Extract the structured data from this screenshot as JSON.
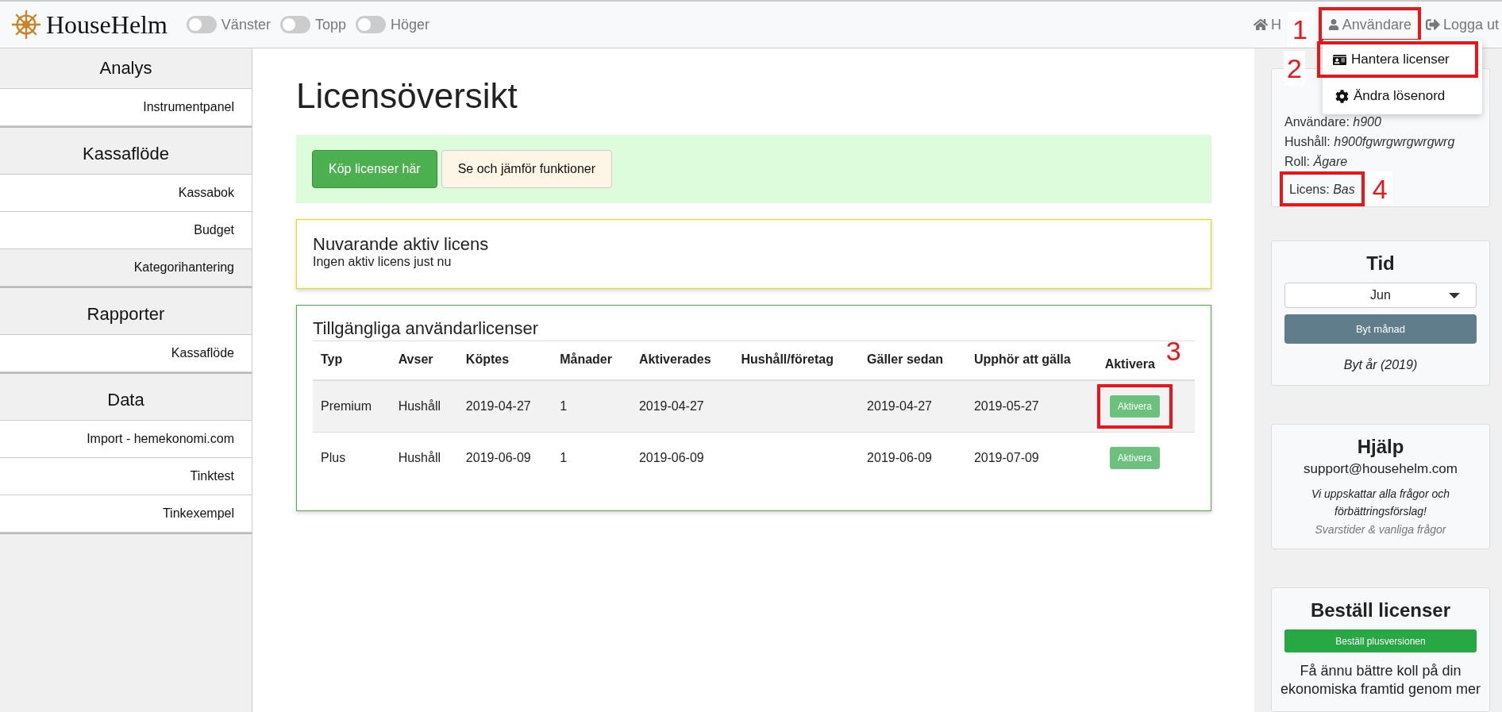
{
  "header": {
    "brand": "HouseHelm",
    "toggles": [
      {
        "label": "Vänster",
        "on": false
      },
      {
        "label": "Topp",
        "on": false
      },
      {
        "label": "Höger",
        "on": false
      }
    ],
    "nav": {
      "home": "H",
      "user": "Användare",
      "user_note": "1",
      "logout": "Logga ut"
    }
  },
  "user_menu": {
    "items": [
      {
        "kind": "license",
        "label": "Hantera licenser",
        "note": "2"
      },
      {
        "kind": "settings",
        "label": "Ändra lösenord"
      }
    ]
  },
  "sidebar": {
    "sections": [
      {
        "title": "Analys",
        "items": [
          {
            "label": "Instrumentpanel",
            "selected": false
          }
        ]
      },
      {
        "title": "Kassaflöde",
        "items": [
          {
            "label": "Kassabok",
            "selected": false
          },
          {
            "label": "Budget",
            "selected": false
          },
          {
            "label": "Kategorihantering",
            "selected": true
          }
        ]
      },
      {
        "title": "Rapporter",
        "items": [
          {
            "label": "Kassaflöde",
            "selected": false
          }
        ]
      },
      {
        "title": "Data",
        "items": [
          {
            "label": "Import - hemekonomi.com",
            "selected": false
          },
          {
            "label": "Tinktest",
            "selected": false
          },
          {
            "label": "Tinkexempel",
            "selected": false
          }
        ]
      }
    ]
  },
  "main": {
    "title": "Licensöversikt",
    "buy_button": "Köp licenser här",
    "compare_button": "Se och jämför funktioner",
    "current": {
      "title": "Nuvarande aktiv licens",
      "text": "Ingen aktiv licens just nu"
    },
    "available": {
      "title": "Tillgängliga användarlicenser",
      "columns": [
        "Typ",
        "Avser",
        "Köptes",
        "Månader",
        "Aktiverades",
        "Hushåll/företag",
        "Gäller sedan",
        "Upphör att gälla",
        "Aktivera"
      ],
      "rows": [
        {
          "cells": [
            "Premium",
            "Hushåll",
            "2019-04-27",
            "1",
            "2019-04-27",
            "",
            "2019-04-27",
            "2019-05-27"
          ],
          "action": "Aktivera",
          "note": "3"
        },
        {
          "cells": [
            "Plus",
            "Hushåll",
            "2019-06-09",
            "1",
            "2019-06-09",
            "",
            "2019-06-09",
            "2019-07-09"
          ],
          "action": "Aktivera"
        }
      ]
    }
  },
  "right": {
    "user_info": [
      {
        "label": "Användare:",
        "value": "h900"
      },
      {
        "label": "Hushåll:",
        "value": "h900fgwrgwrgwrgwrg"
      },
      {
        "label": "Roll:",
        "value": "Ägare"
      },
      {
        "label": "Licens:",
        "value": "Bas",
        "note": "4"
      }
    ],
    "time": {
      "title": "Tid",
      "month": "Jun",
      "month_button": "Byt månad",
      "year_link": "Byt år (2019)"
    },
    "help": {
      "title": "Hjälp",
      "email": "support@househelm.com",
      "note": "Vi uppskattar alla frågor och förbättringsförslag!",
      "faq_link": "Svarstider & vanliga frågor"
    },
    "order": {
      "title": "Beställ licenser",
      "button": "Beställ plusversionen",
      "text": "Få ännu bättre koll på din ekonomiska framtid genom mer"
    }
  }
}
